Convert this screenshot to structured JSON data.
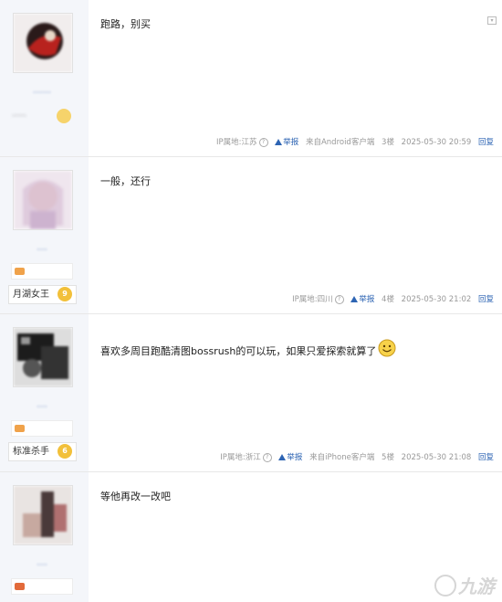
{
  "posts": [
    {
      "text": "跑路，别买",
      "username": "·······",
      "ip": "IP属地:江苏",
      "report": "举报",
      "client": "来自Android客户端",
      "floor": "3楼",
      "time": "2025-05-30 20:59",
      "reply": "回复",
      "level_title": "·····",
      "level_num": ""
    },
    {
      "text": "一般，还行",
      "username": "····",
      "ip": "IP属地:四川",
      "report": "举报",
      "client": "",
      "floor": "4楼",
      "time": "2025-05-30 21:02",
      "reply": "回复",
      "level_title": "月湖女王",
      "level_num": "9"
    },
    {
      "text": "喜欢多周目跑酷清图bossrush的可以玩，如果只爱探索就算了",
      "username": "····",
      "ip": "IP属地:浙江",
      "report": "举报",
      "client": "来自iPhone客户端",
      "floor": "5楼",
      "time": "2025-05-30 21:08",
      "reply": "回复",
      "level_title": "标准杀手",
      "level_num": "6"
    },
    {
      "text": "等他再改一改吧",
      "username": "····"
    }
  ],
  "watermark": "九游",
  "colors": {
    "link": "#2d64b3",
    "sidebar": "#f4f6fa",
    "badge": "#f2c03a"
  }
}
